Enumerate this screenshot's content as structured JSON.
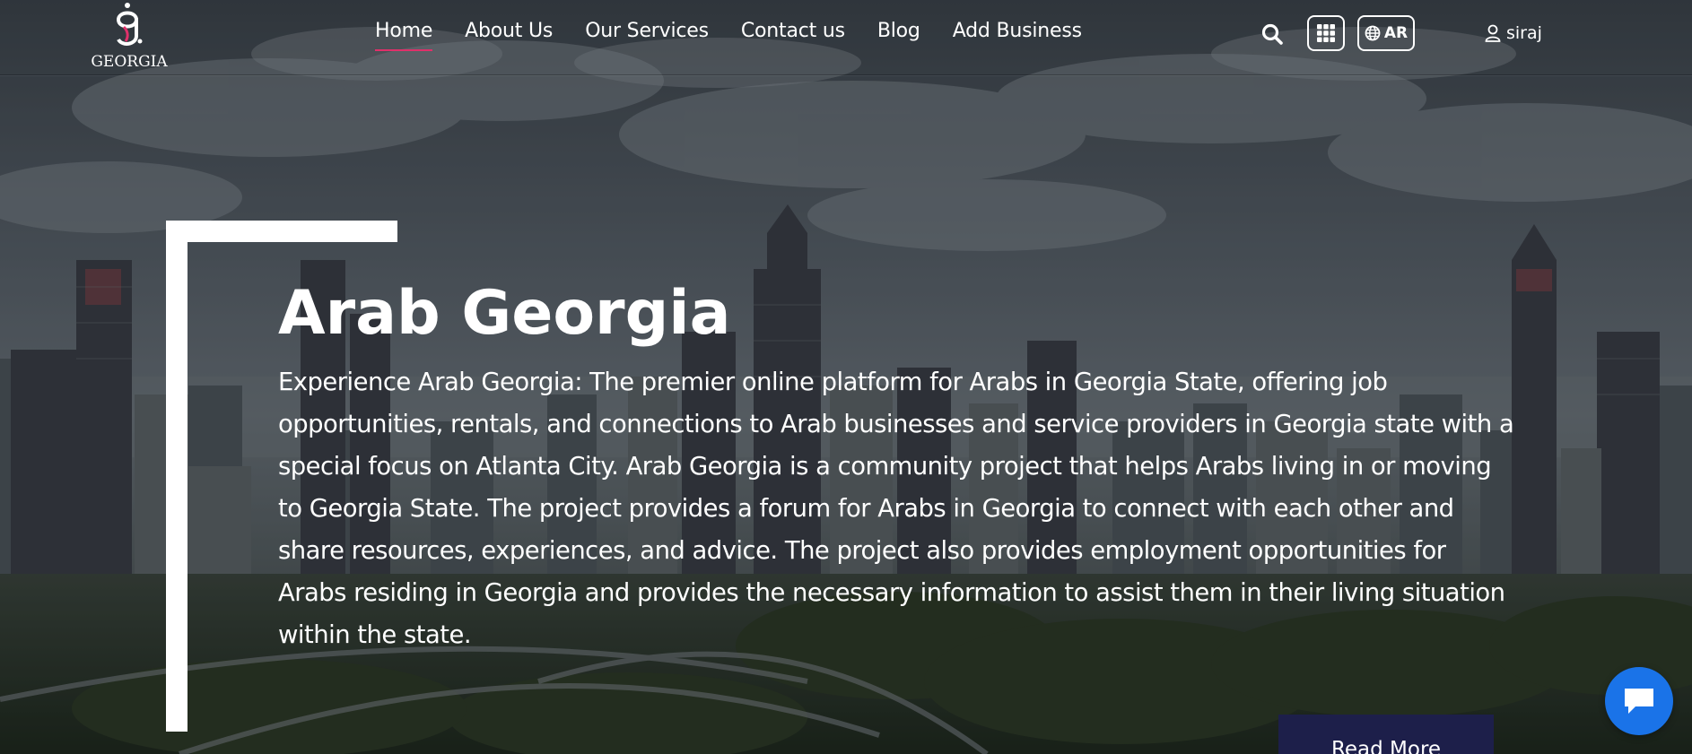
{
  "brand": {
    "logo_text": "GEORGIA",
    "logo_mark": "g.",
    "accent_color": "#e0306a"
  },
  "nav": {
    "items": [
      {
        "label": "Home",
        "active": true
      },
      {
        "label": "About Us",
        "active": false
      },
      {
        "label": "Our Services",
        "active": false
      },
      {
        "label": "Contact us",
        "active": false
      },
      {
        "label": "Blog",
        "active": false
      },
      {
        "label": "Add Business",
        "active": false
      }
    ]
  },
  "header_actions": {
    "search_icon": "search-icon",
    "apps_icon": "grid-icon",
    "language_icon": "globe-icon",
    "language_label": "AR",
    "user_icon": "user-icon",
    "user_name": "siraj"
  },
  "hero": {
    "title": "Arab Georgia",
    "description": "Experience Arab Georgia: The premier online platform for Arabs in Georgia State, offering job opportunities, rentals, and connections to Arab businesses and service providers in Georgia state with a special focus on Atlanta City. Arab Georgia is a community project that helps Arabs living in or moving to Georgia State. The project provides a forum for Arabs in Georgia to connect with each other and share resources, experiences, and advice. The project also provides employment opportunities for Arabs residing in Georgia and provides the necessary information to assist them in their living situation within the state.",
    "read_more_label": "Read More",
    "read_more_color": "#1d1f4a"
  },
  "chat_widget": {
    "icon": "chat-bubble-icon",
    "color": "#1a73e8"
  }
}
